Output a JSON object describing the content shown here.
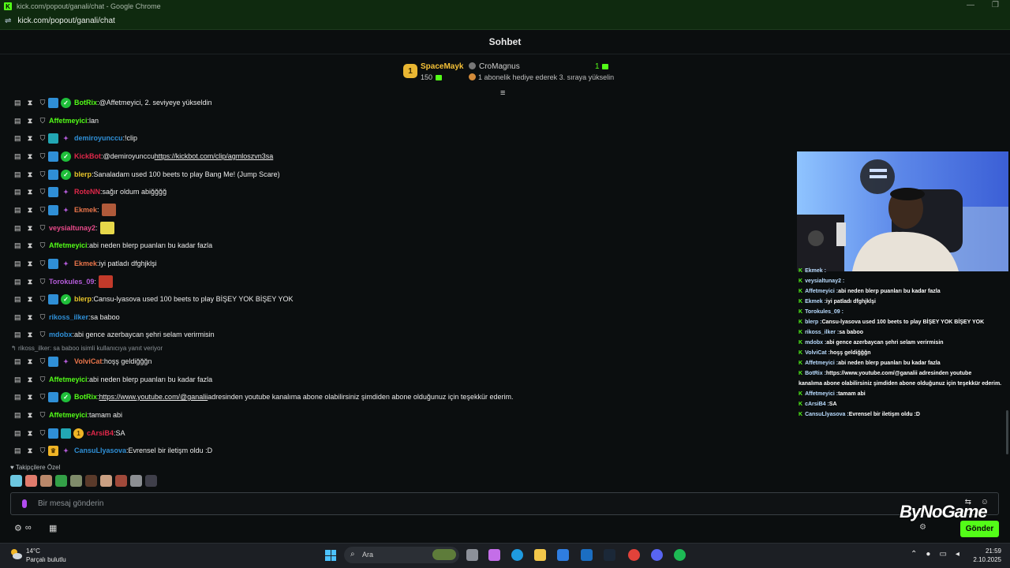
{
  "window": {
    "title": "kick.com/popout/ganali/chat - Google Chrome",
    "url": "kick.com/popout/ganali/chat",
    "minimize": "—",
    "restore": "❐",
    "close": "✕",
    "tune_icon": "⇌"
  },
  "header": {
    "title": "Sohbet"
  },
  "leaderboard": {
    "first_rank": "1",
    "first_name": "SpaceMayk",
    "first_count": "150",
    "second_name": "CroMagnus",
    "second_text": "1 abonelik hediye ederek 3. sıraya yükselin",
    "right_count": "1"
  },
  "chat": {
    "reply_context": "rikoss_ilker: sa baboo isimli kullanıcıya yanıt veriyor",
    "messages": [
      {
        "user": "BotRix",
        "color": "#53fc18",
        "text": "@Affetmeyici, 2. seviyeye yükseldin",
        "link": ""
      },
      {
        "user": "Affetmeyici",
        "color": "#53fc18",
        "text": "lan",
        "link": ""
      },
      {
        "user": "demiroyunccu",
        "color": "#2f8fd6",
        "text": "!clip",
        "link": ""
      },
      {
        "user": "KickBot",
        "color": "#e0284a",
        "text": "@demiroyunccu ",
        "link": "https://kickbot.com/clip/agmloszvn3sa"
      },
      {
        "user": "blerp",
        "color": "#e8c52a",
        "text": "Sanaladam used 100 beets to play Bang Me! (Jump Scare)",
        "link": ""
      },
      {
        "user": "RoteNN",
        "color": "#e0284a",
        "text": "sağır oldum abiğğğğ",
        "link": ""
      },
      {
        "user": "Ekmek",
        "color": "#e8744a",
        "text": "",
        "link": ""
      },
      {
        "user": "veysialtunay2",
        "color": "#e84a8a",
        "text": "",
        "link": ""
      },
      {
        "user": "Affetmeyici",
        "color": "#53fc18",
        "text": "abi neden blerp puanları bu kadar fazla",
        "link": ""
      },
      {
        "user": "Ekmek",
        "color": "#e8744a",
        "text": "iyi patladı dfghjklşi",
        "link": ""
      },
      {
        "user": "Torokules_09",
        "color": "#b35bd8",
        "text": "",
        "link": ""
      },
      {
        "user": "blerp",
        "color": "#e8c52a",
        "text": "Cansu-lyasova used 100 beets to play BİŞEY YOK BİŞEY YOK",
        "link": ""
      },
      {
        "user": "rikoss_ilker",
        "color": "#2f8fd6",
        "text": "sa baboo",
        "link": ""
      },
      {
        "user": "mdobx",
        "color": "#2f8fd6",
        "text": "abi gence azerbaycan şehri selam verirmisin",
        "link": ""
      },
      {
        "user": "VolviCat",
        "color": "#e8744a",
        "text": "hoşş geldiğğğn",
        "link": ""
      },
      {
        "user": "Affetmeyici",
        "color": "#53fc18",
        "text": "abi neden blerp puanları bu kadar fazla",
        "link": ""
      },
      {
        "user": "BotRix",
        "color": "#53fc18",
        "text": " adresinden youtube kanalıma abone olabilirsiniz şimdiden abone olduğunuz için teşekkür ederim.",
        "link": "https://www.youtube.com/@ganalii"
      },
      {
        "user": "Affetmeyici",
        "color": "#53fc18",
        "text": "tamam abi",
        "link": ""
      },
      {
        "user": "cArsiB4",
        "color": "#e0284a",
        "text": "SA",
        "link": ""
      },
      {
        "user": "CansuLlyasova",
        "color": "#2f8fd6",
        "text": "Evrensel bir iletişm oldu :D",
        "link": ""
      }
    ]
  },
  "followers_label": "Takipçilere Özel",
  "input": {
    "placeholder": "Bir mesaj gönderin"
  },
  "send_label": "Gönder",
  "overlay": {
    "lines": [
      {
        "user": "Ekmek",
        "text": ""
      },
      {
        "user": "veysialtunay2",
        "text": ""
      },
      {
        "user": "Affetmeyici",
        "text": "abi neden blerp puanları bu kadar fazla"
      },
      {
        "user": "Ekmek",
        "text": "iyi patladı dfghjklşi"
      },
      {
        "user": "Torokules_09",
        "text": ""
      },
      {
        "user": "blerp",
        "text": "Cansu-lyasova used 100 beets to play BİŞEY YOK BİŞEY YOK"
      },
      {
        "user": "rikoss_ilker",
        "text": "sa baboo"
      },
      {
        "user": "mdobx",
        "text": "abi gence azerbaycan şehri selam verirmisin"
      },
      {
        "user": "VolviCat",
        "text": "hoşş geldiğğğn"
      },
      {
        "user": "Affetmeyici",
        "text": "abi neden blerp puanları bu kadar fazla"
      },
      {
        "user": "BotRix",
        "text": "https://www.youtube.com/@ganalii adresinden youtube"
      },
      {
        "user": "",
        "text": "kanalıma abone olabilirsiniz şimdiden abone olduğunuz için teşekkür ederim."
      },
      {
        "user": "Affetmeyici",
        "text": "tamam abi"
      },
      {
        "user": "cArsiB4",
        "text": "SA"
      },
      {
        "user": "CansuLlyasova",
        "text": "Evrensel bir iletişm oldu :D"
      }
    ],
    "watermark": "ByNoGame"
  },
  "taskbar": {
    "temp": "14°C",
    "weather": "Parçalı bulutlu",
    "search": "Ara",
    "time": "21:59",
    "date": "2.10.2025"
  }
}
